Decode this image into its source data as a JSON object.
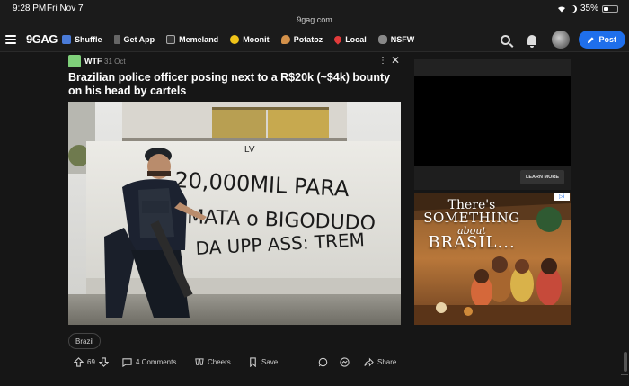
{
  "status_bar": {
    "time": "9:28 PM",
    "date": "Fri Nov 7",
    "url": "9gag.com",
    "battery": "35%",
    "battery_level": 0.35
  },
  "nav": {
    "logo": "9GAG",
    "items": [
      {
        "label": "Shuffle",
        "icon": "shuffle-icon"
      },
      {
        "label": "Get App",
        "icon": "phone-icon"
      },
      {
        "label": "Memeland",
        "icon": "memeland-icon"
      },
      {
        "label": "Moonit",
        "icon": "moonit-icon"
      },
      {
        "label": "Potatoz",
        "icon": "potatoz-icon"
      },
      {
        "label": "Local",
        "icon": "pin-icon"
      },
      {
        "label": "NSFW",
        "icon": "nsfw-icon"
      }
    ],
    "post_label": "Post",
    "accent": "#1f6feb"
  },
  "post": {
    "section": "WTF",
    "date": "31 Oct",
    "title": "Brazilian police officer posing next to a R$20k (~$4k) bounty on his head by cartels",
    "image": {
      "graffiti_lines": [
        "20,000MIL PARA",
        "MATA o BIGODUDO",
        "DA UPP ASS: TREM"
      ],
      "graffiti_top": "LV"
    },
    "tag": "Brazil",
    "upvotes": "69",
    "comments": "4 Comments",
    "cheers": "Cheers",
    "save": "Save",
    "share": "Share"
  },
  "ads": {
    "ad1_button": "LEARN MORE",
    "ad2_lines": [
      "There's",
      "SOMETHING",
      "about",
      "BRASIL..."
    ]
  }
}
